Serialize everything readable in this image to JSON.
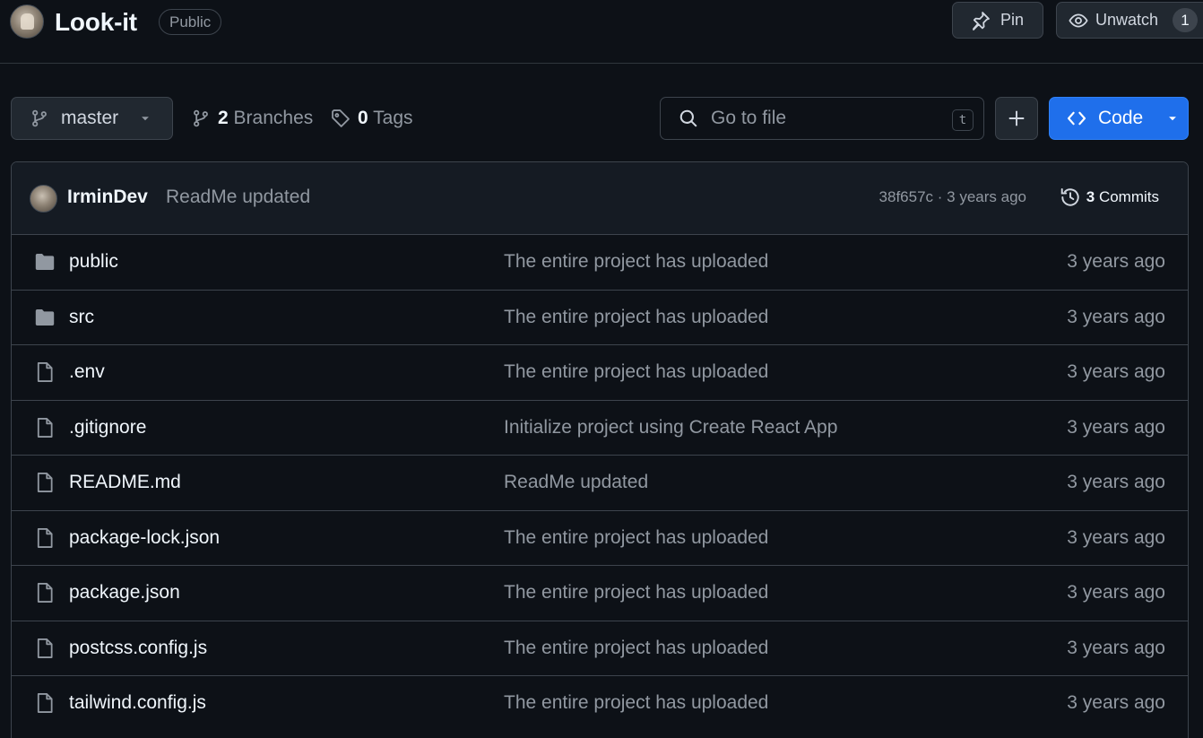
{
  "repo": {
    "name": "Look-it",
    "visibility": "Public"
  },
  "header_actions": {
    "pin_label": "Pin",
    "watch_label": "Unwatch",
    "watch_count": "1"
  },
  "toolbar": {
    "branch": "master",
    "branches_count": "2",
    "branches_label": "Branches",
    "tags_count": "0",
    "tags_label": "Tags",
    "search_placeholder": "Go to file",
    "search_shortcut": "t",
    "code_label": "Code"
  },
  "latest_commit": {
    "author": "IrminDev",
    "message": "ReadMe updated",
    "meta": "38f657c · 3 years ago",
    "commits_count": "3",
    "commits_label": "Commits"
  },
  "files": [
    {
      "type": "folder",
      "name": "public",
      "message": "The entire project has uploaded",
      "age": "3 years ago"
    },
    {
      "type": "folder",
      "name": "src",
      "message": "The entire project has uploaded",
      "age": "3 years ago"
    },
    {
      "type": "file",
      "name": ".env",
      "message": "The entire project has uploaded",
      "age": "3 years ago"
    },
    {
      "type": "file",
      "name": ".gitignore",
      "message": "Initialize project using Create React App",
      "age": "3 years ago"
    },
    {
      "type": "file",
      "name": "README.md",
      "message": "ReadMe updated",
      "age": "3 years ago"
    },
    {
      "type": "file",
      "name": "package-lock.json",
      "message": "The entire project has uploaded",
      "age": "3 years ago"
    },
    {
      "type": "file",
      "name": "package.json",
      "message": "The entire project has uploaded",
      "age": "3 years ago"
    },
    {
      "type": "file",
      "name": "postcss.config.js",
      "message": "The entire project has uploaded",
      "age": "3 years ago"
    },
    {
      "type": "file",
      "name": "tailwind.config.js",
      "message": "The entire project has uploaded",
      "age": "3 years ago"
    }
  ],
  "icons": {
    "folder": "folder-icon",
    "file": "file-icon"
  },
  "colors": {
    "background": "#0d1117",
    "accent": "#1f6feb",
    "border": "#3d444d",
    "muted_text": "#9198a1"
  }
}
